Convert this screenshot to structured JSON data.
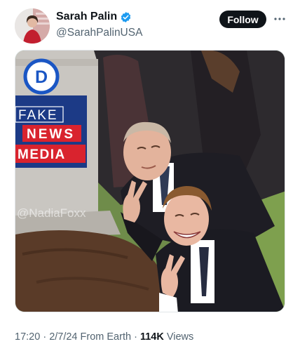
{
  "author": {
    "display_name": "Sarah Palin",
    "handle": "@SarahPalinUSA"
  },
  "actions": {
    "follow_label": "Follow",
    "more_icon": "ellipsis-icon"
  },
  "image": {
    "party_logo_letter": "D",
    "banner_line1": "FAKE",
    "banner_line2": "NEWS",
    "banner_line3": "MEDIA",
    "watermark": "@NadiaFoxx"
  },
  "meta": {
    "time": "17:20",
    "date": "2/7/24",
    "source": "From Earth",
    "views_count": "114K",
    "views_label": "Views"
  },
  "colors": {
    "follow_bg": "#0f1419",
    "verified_blue": "#1d9bf0",
    "muted_text": "#536471",
    "banner_red": "#d9232e",
    "banner_blue": "#1c3a86"
  }
}
